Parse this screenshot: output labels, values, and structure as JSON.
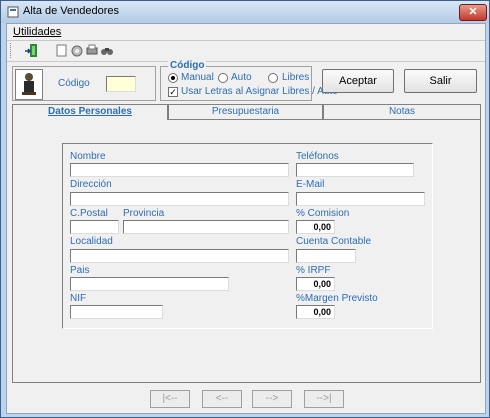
{
  "window": {
    "title": "Alta de Vendedores",
    "close": "✕"
  },
  "menu": {
    "utilidades": "Utilidades"
  },
  "codigo_label": "Código",
  "codigo_group": {
    "legend": "Código",
    "manual": "Manual",
    "auto": "Auto",
    "libres": "Libres",
    "selected": "Manual",
    "usar_letras": "Usar Letras al Asignar Libres / Auto",
    "usar_letras_checked": true
  },
  "buttons": {
    "aceptar": "Aceptar",
    "salir": "Salir"
  },
  "tabs": [
    "Datos Personales",
    "Presupuestaria",
    "Notas"
  ],
  "fields": {
    "nombre": "Nombre",
    "direccion": "Dirección",
    "cpostal": "C.Postal",
    "provincia": "Provincia",
    "localidad": "Localidad",
    "pais": "Pais",
    "nif": "NIF",
    "telefonos": "Teléfonos",
    "email": "E-Mail",
    "comision": "% Comision",
    "comision_value": "0,00",
    "cuenta": "Cuenta Contable",
    "irpf": "% IRPF",
    "irpf_value": "0,00",
    "margen": "%Margen Previsto",
    "margen_value": "0,00"
  },
  "nav": {
    "first": "|<--",
    "prev": "<--",
    "next": "-->",
    "last": "-->|"
  }
}
